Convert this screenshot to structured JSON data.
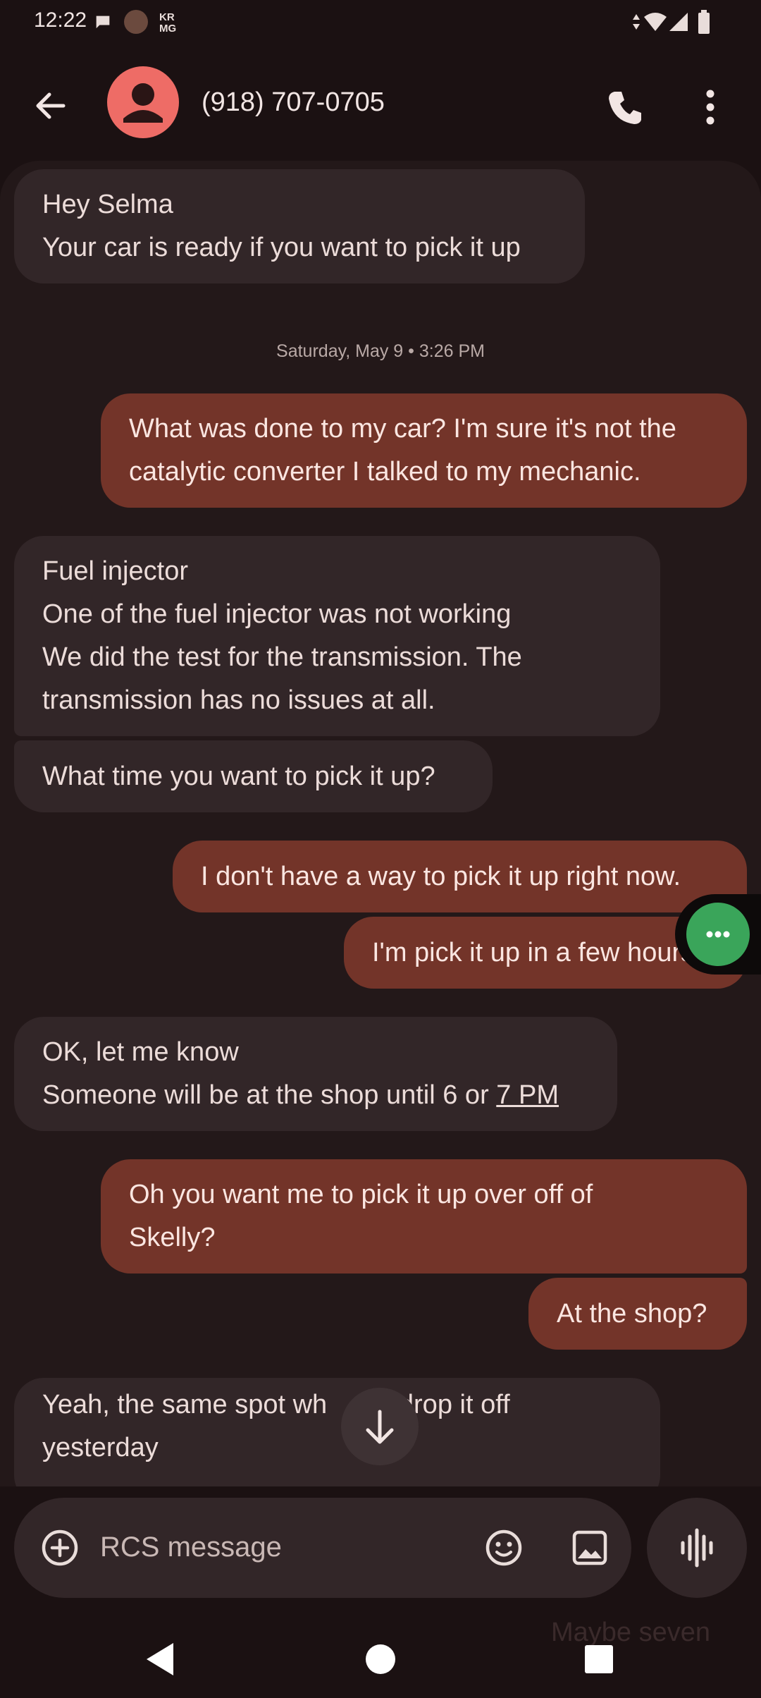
{
  "status": {
    "time": "12:22",
    "notification_badge": "KR\nMG"
  },
  "header": {
    "contact": "(918) 707-0705"
  },
  "messages": {
    "m1": {
      "line1": "Hey Selma",
      "line2": "Your car is ready if you want to pick it up"
    },
    "timestamp": "Saturday, May 9 • 3:26 PM",
    "m2": {
      "line1": "What was done to my car? I'm sure it's not the",
      "line2": "catalytic converter I talked to my mechanic."
    },
    "m3": {
      "line1": "Fuel injector",
      "line2": "One of the fuel injector was not working",
      "line3": "We did the test for the transmission. The",
      "line4": "transmission has no issues at all."
    },
    "m4": "What time you want to pick it up?",
    "m5": "I don't have a way to pick it up right now.",
    "m6": "I'm pick it up in a few hours",
    "m7": {
      "line1": "OK, let me know",
      "line2_pre": "Someone will be at the shop until 6 or ",
      "line2_link": "7 PM"
    },
    "m8": {
      "line1": "Oh you want me to pick it up over off of",
      "line2": "Skelly?"
    },
    "m9": "At the shop?",
    "m10": {
      "line1": "Yeah, the same spot wh",
      "line1_post": "u drop it off",
      "line2": "yesterday"
    }
  },
  "composer": {
    "placeholder": "RCS message",
    "ghost_text": "Maybe seven"
  },
  "icons": {
    "back": "arrow-left-icon",
    "avatar": "person-icon",
    "call": "phone-icon",
    "more": "more-vertical-icon",
    "add": "add-circle-icon",
    "emoji": "emoji-icon",
    "gallery": "image-icon",
    "voice": "voice-waveform-icon",
    "scroll": "arrow-down-icon",
    "fab": "more-horizontal-icon"
  },
  "colors": {
    "background": "#1b1112",
    "incoming": "#322628",
    "outgoing": "#733429",
    "avatar": "#ee6c66",
    "fab": "#3aa55a"
  }
}
